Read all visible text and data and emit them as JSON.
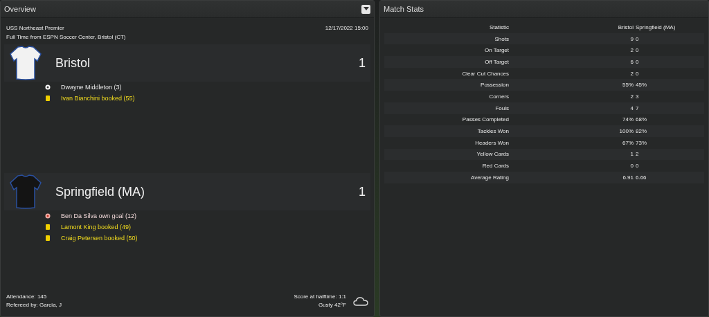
{
  "overview": {
    "title": "Overview",
    "competition": "USS Northeast Premier",
    "date": "12/17/2022 15:00",
    "venue": "Full Time from ESPN Soccer Center, Bristol (CT)",
    "teams": [
      {
        "name": "Bristol",
        "score": "1",
        "color": "#f2f2f2",
        "events": [
          {
            "kind": "goal",
            "text": "Dwayne Middleton (3)"
          },
          {
            "kind": "booking",
            "text": "Ivan Bianchini booked (55)"
          }
        ]
      },
      {
        "name": "Springfield (MA)",
        "score": "1",
        "color": "#141414",
        "events": [
          {
            "kind": "own_goal",
            "text": "Ben Da Silva own goal (12)"
          },
          {
            "kind": "booking",
            "text": "Lamont King booked (49)"
          },
          {
            "kind": "booking",
            "text": "Craig Petersen booked (50)"
          }
        ]
      }
    ],
    "attendance": "Attendance: 145",
    "referee": "Refereed by: Garcia, J",
    "halftime": "Score at halftime: 1:1",
    "weather": "Gusty 42°F"
  },
  "match_stats": {
    "title": "Match Stats",
    "columns": [
      "Statistic",
      "Bristol",
      "Springfield (MA)"
    ],
    "rows": [
      [
        "Shots",
        "9",
        "0"
      ],
      [
        "On Target",
        "2",
        "0"
      ],
      [
        "Off Target",
        "6",
        "0"
      ],
      [
        "Clear Cut Chances",
        "2",
        "0"
      ],
      [
        "Possession",
        "55%",
        "45%"
      ],
      [
        "Corners",
        "2",
        "3"
      ],
      [
        "Fouls",
        "4",
        "7"
      ],
      [
        "Passes Completed",
        "74%",
        "68%"
      ],
      [
        "Tackles Won",
        "100%",
        "82%"
      ],
      [
        "Headers Won",
        "67%",
        "73%"
      ],
      [
        "Yellow Cards",
        "1",
        "2"
      ],
      [
        "Red Cards",
        "0",
        "0"
      ],
      [
        "Average Rating",
        "6.91",
        "6.66"
      ]
    ]
  }
}
